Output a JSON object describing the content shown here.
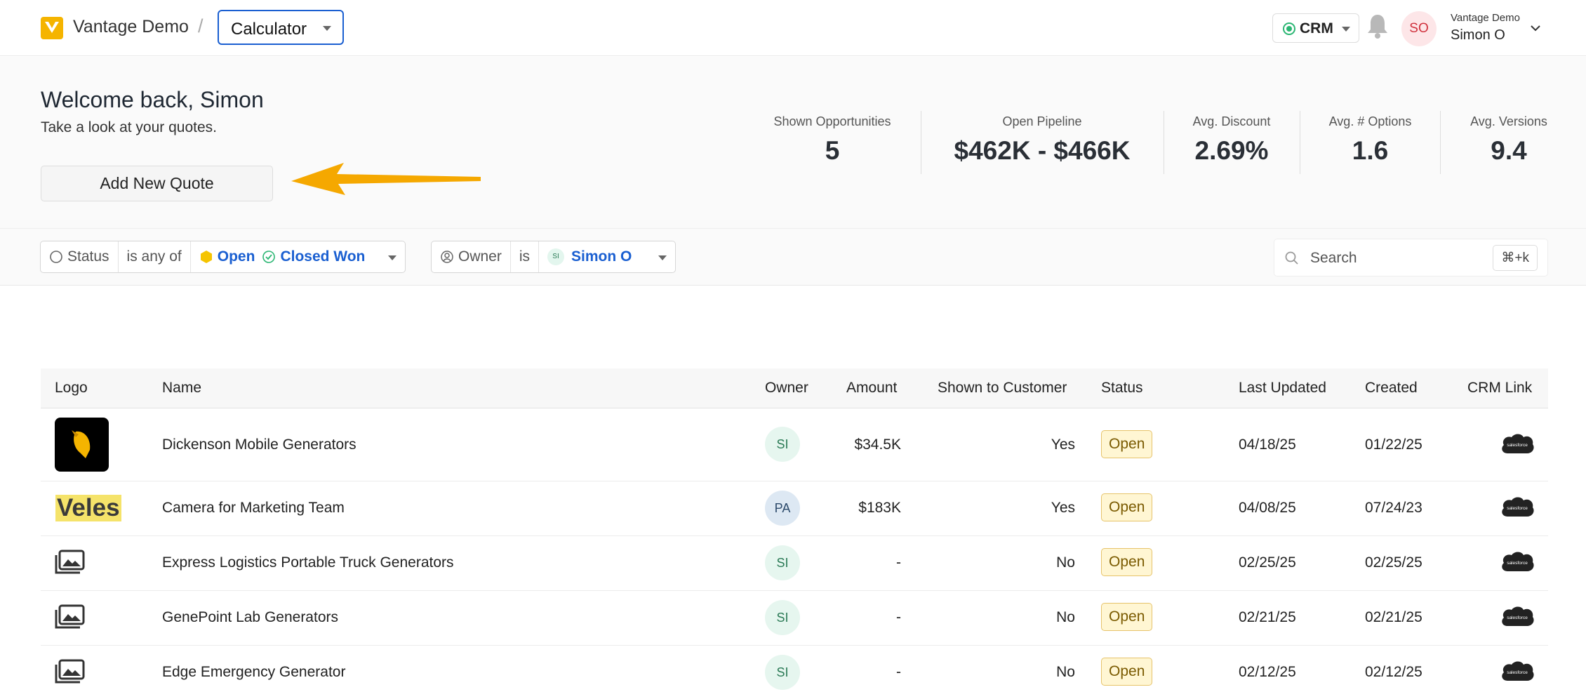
{
  "header": {
    "org_name": "Vantage Demo",
    "separator": "/",
    "app_select": "Calculator",
    "crm_button": "CRM",
    "user_initials": "SO",
    "user_org": "Vantage Demo",
    "user_name": "Simon O"
  },
  "hero": {
    "welcome": "Welcome back, Simon",
    "subtitle": "Take a look at your quotes.",
    "add_button": "Add New Quote",
    "stats": [
      {
        "label": "Shown Opportunities",
        "value": "5"
      },
      {
        "label": "Open Pipeline",
        "value": "$462K - $466K"
      },
      {
        "label": "Avg. Discount",
        "value": "2.69%"
      },
      {
        "label": "Avg. # Options",
        "value": "1.6"
      },
      {
        "label": "Avg. Versions",
        "value": "9.4"
      }
    ]
  },
  "filters": {
    "status": {
      "field": "Status",
      "op": "is any of",
      "values": [
        "Open",
        "Closed Won"
      ]
    },
    "owner": {
      "field": "Owner",
      "op": "is",
      "avatar": "SI",
      "value": "Simon O"
    },
    "search_placeholder": "Search",
    "shortcut": "⌘+k"
  },
  "table": {
    "columns": [
      "Logo",
      "Name",
      "Owner",
      "Amount",
      "Shown to Customer",
      "Status",
      "Last Updated",
      "Created",
      "CRM Link"
    ],
    "rows": [
      {
        "logo": "bird-logo",
        "name": "Dickenson Mobile Generators",
        "owner": "SI",
        "amount": "$34.5K",
        "shown": "Yes",
        "status": "Open",
        "updated": "04/18/25",
        "created": "01/22/25",
        "crm": "salesforce"
      },
      {
        "logo": "Veles",
        "name": "Camera for Marketing Team",
        "owner": "PA",
        "amount": "$183K",
        "shown": "Yes",
        "status": "Open",
        "updated": "04/08/25",
        "created": "07/24/23",
        "crm": "salesforce"
      },
      {
        "logo": "image-placeholder-icon",
        "name": "Express Logistics Portable Truck Generators",
        "owner": "SI",
        "amount": "-",
        "shown": "No",
        "status": "Open",
        "updated": "02/25/25",
        "created": "02/25/25",
        "crm": "salesforce"
      },
      {
        "logo": "image-placeholder-icon",
        "name": "GenePoint Lab Generators",
        "owner": "SI",
        "amount": "-",
        "shown": "No",
        "status": "Open",
        "updated": "02/21/25",
        "created": "02/21/25",
        "crm": "salesforce"
      },
      {
        "logo": "image-placeholder-icon",
        "name": "Edge Emergency Generator",
        "owner": "SI",
        "amount": "-",
        "shown": "No",
        "status": "Open",
        "updated": "02/12/25",
        "created": "02/12/25",
        "crm": "salesforce"
      }
    ]
  },
  "colors": {
    "accent": "#1a5fd1",
    "brand": "#f5b400",
    "status_open_bg": "#fff6d3",
    "arrow": "#f5a800"
  }
}
